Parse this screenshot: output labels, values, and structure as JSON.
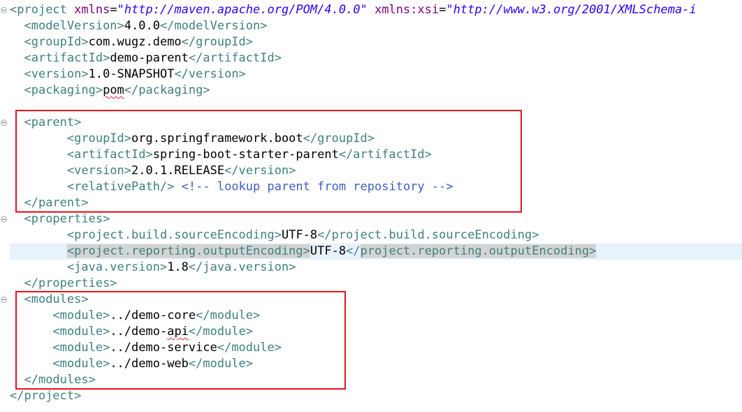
{
  "project": {
    "open_tag": "project",
    "xmlns_attr": "xmlns",
    "xmlns_value": "\"http://maven.apache.org/POM/4.0.0\"",
    "xsi_attr": "xmlns:xsi",
    "xsi_value": "\"http://www.w3.org/2001/XMLSchema-i"
  },
  "header": {
    "modelVersion": "4.0.0",
    "groupId": "com.wugz.demo",
    "artifactId": "demo-parent",
    "version": "1.0-SNAPSHOT",
    "packaging": "pom"
  },
  "parent": {
    "groupId": "org.springframework.boot",
    "artifactId": "spring-boot-starter-parent",
    "version": "2.0.1.RELEASE",
    "relativePath_tag": "<relativePath/>",
    "comment": "<!-- lookup parent from repository -->"
  },
  "properties": {
    "sourceEncoding_tag": "project.build.sourceEncoding",
    "sourceEncoding": "UTF-8",
    "outputEncoding_tag": "project.reporting.outputEncoding",
    "outputEncoding": "UTF-8",
    "java_version": "1.8"
  },
  "modules": [
    "../demo-core",
    "../demo-api",
    "../demo-service",
    "../demo-web"
  ],
  "colors": {
    "tag": "#3f7f7f",
    "attribute_name": "#7f007f",
    "attribute_value": "#2a00ff",
    "comment": "#3f5fbf",
    "annotation_box": "#e3161d"
  }
}
